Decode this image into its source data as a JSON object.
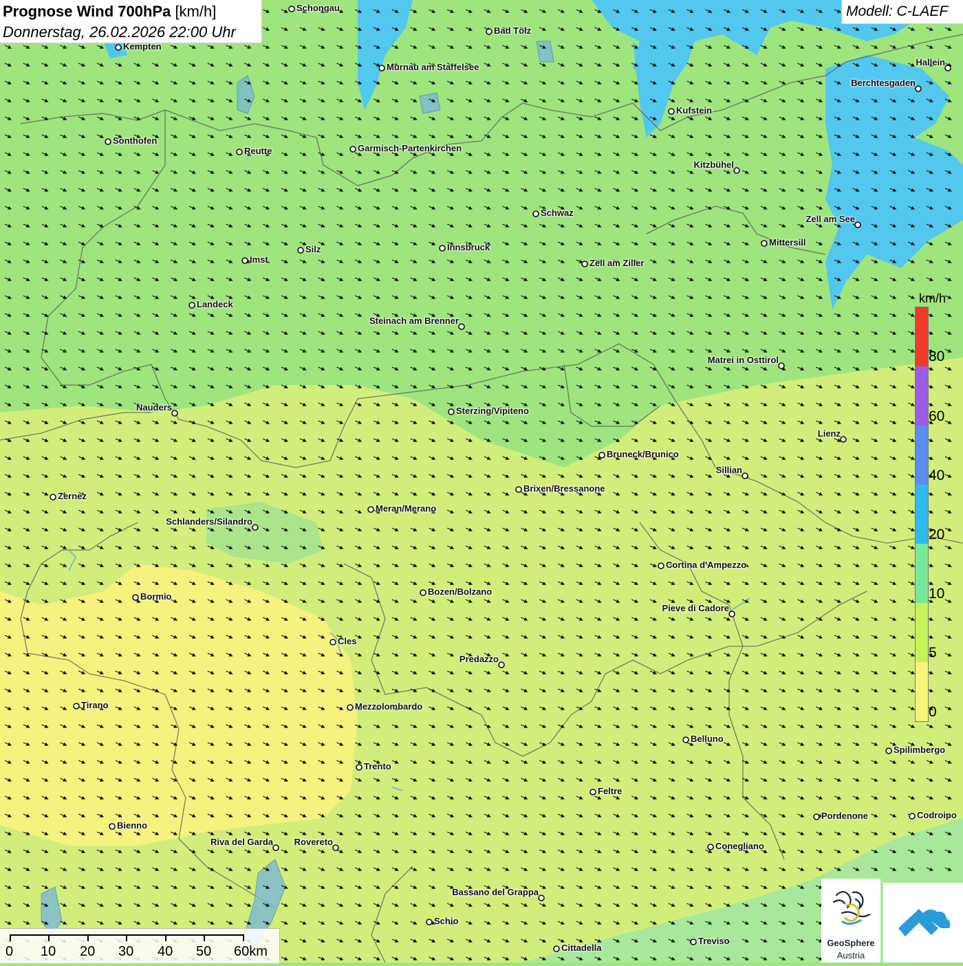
{
  "title": {
    "main": "Prognose Wind 700hPa",
    "unit": "[km/h]",
    "datetime": "Donnerstag, 26.02.2026 22:00 Uhr"
  },
  "model_label": "Modell: C-LAEF",
  "legend": {
    "unit": "km/h",
    "labels": [
      "80",
      "60",
      "40",
      "20",
      "10",
      "5",
      "0"
    ],
    "colors": [
      "#ef3b2c",
      "#9b5de5",
      "#5b8def",
      "#2ebaf0",
      "#7ae89a",
      "#c6f25a",
      "#f8f47a"
    ]
  },
  "scalebar": {
    "labels": [
      "0",
      "10",
      "20",
      "30",
      "40",
      "50",
      "60km"
    ]
  },
  "logos": {
    "geosphere_name": "GeoSphere",
    "geosphere_sub": "Austria"
  },
  "wind_direction": "northwest",
  "cities": [
    {
      "name": "Schongau"
    },
    {
      "name": "Bad Tölz"
    },
    {
      "name": "Kempten"
    },
    {
      "name": "Murnau am Staffelsee"
    },
    {
      "name": "Hallein"
    },
    {
      "name": "Berchtesgaden"
    },
    {
      "name": "Kufstein"
    },
    {
      "name": "Sonthofen"
    },
    {
      "name": "Reutte"
    },
    {
      "name": "Garmisch-Partenkirchen"
    },
    {
      "name": "Kitzbühel"
    },
    {
      "name": "Schwaz"
    },
    {
      "name": "Zell am See"
    },
    {
      "name": "Mittersill"
    },
    {
      "name": "Innsbruck"
    },
    {
      "name": "Silz"
    },
    {
      "name": "Imst"
    },
    {
      "name": "Zell am Ziller"
    },
    {
      "name": "Landeck"
    },
    {
      "name": "Steinach am Brenner"
    },
    {
      "name": "Matrei in Osttirol"
    },
    {
      "name": "Nauders"
    },
    {
      "name": "Sterzing/Vipiteno"
    },
    {
      "name": "Lienz"
    },
    {
      "name": "Bruneck/Brunico"
    },
    {
      "name": "Sillian"
    },
    {
      "name": "Zernez"
    },
    {
      "name": "Brixen/Bressanone"
    },
    {
      "name": "Meran/Merano"
    },
    {
      "name": "Schlanders/Silandro"
    },
    {
      "name": "Cortina d'Ampezzo"
    },
    {
      "name": "Bozen/Bolzano"
    },
    {
      "name": "Bormio"
    },
    {
      "name": "Pieve di Cadore"
    },
    {
      "name": "Cles"
    },
    {
      "name": "Predazzo"
    },
    {
      "name": "Tirano"
    },
    {
      "name": "Mezzolombardo"
    },
    {
      "name": "Belluno"
    },
    {
      "name": "Spilimbergo"
    },
    {
      "name": "Trento"
    },
    {
      "name": "Feltre"
    },
    {
      "name": "Pordenone"
    },
    {
      "name": "Codroipo"
    },
    {
      "name": "Bienno"
    },
    {
      "name": "Riva del Garda"
    },
    {
      "name": "Rovereto"
    },
    {
      "name": "Conegliano"
    },
    {
      "name": "Bassano del Grappa"
    },
    {
      "name": "Schio"
    },
    {
      "name": "Treviso"
    },
    {
      "name": "Cittadella"
    }
  ]
}
